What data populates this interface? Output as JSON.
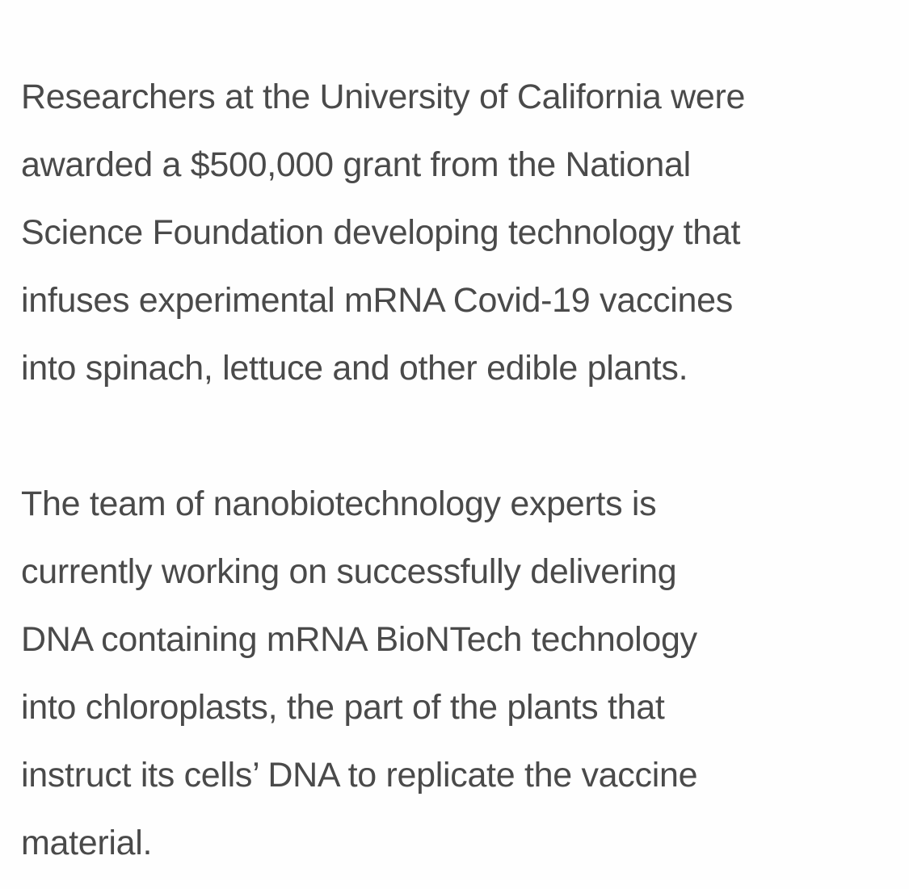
{
  "article": {
    "paragraphs": [
      {
        "lines": [
          "Researchers at the University of California were",
          "awarded a $500,000 grant from the National",
          "Science Foundation developing technology that",
          "infuses experimental mRNA Covid-19 vaccines",
          "into spinach, lettuce and other edible plants."
        ]
      },
      {
        "lines": [
          "The team of nanobiotechnology experts is",
          "currently working on successfully delivering",
          "DNA containing mRNA BioNTech technology",
          "into chloroplasts, the part of the plants that",
          "instruct its cells’ DNA to replicate the vaccine",
          "material."
        ]
      }
    ]
  }
}
